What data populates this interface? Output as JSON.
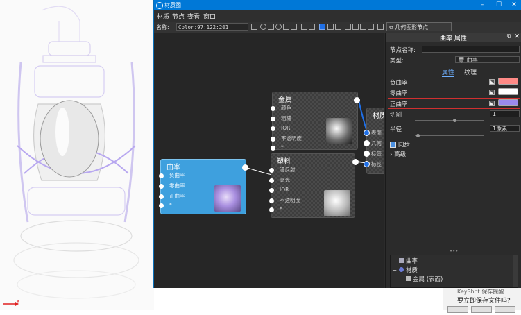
{
  "window": {
    "title": "材质图",
    "minimize": "–",
    "maximize": "☐",
    "close": "✕"
  },
  "menu": [
    "材质",
    "节点",
    "查看",
    "窗口"
  ],
  "toolbar": {
    "name_label": "名称:",
    "name_value": "Color:97:122:201",
    "geometry_button": "几何图形节点"
  },
  "nodes": {
    "metal": {
      "title": "金属",
      "pins": [
        "颜色",
        "粗糙",
        "IOR",
        "不透明度",
        "*"
      ]
    },
    "plastic": {
      "title": "塑料",
      "pins": [
        "漫反射",
        "高光",
        "IOR",
        "不透明度",
        "*"
      ]
    },
    "curvature": {
      "title": "曲率",
      "pins": [
        "负曲率",
        "零曲率",
        "正曲率",
        "*"
      ]
    },
    "material": {
      "title": "材质",
      "pins": [
        "表面",
        "几何",
        "标签",
        "标签"
      ]
    }
  },
  "props": {
    "header": "曲率 属性",
    "node_name_label": "节点名称:",
    "node_name_value": "",
    "type_label": "类型:",
    "type_value": "曲率",
    "tab_properties": "属性",
    "tab_texture": "纹理",
    "neg_label": "负曲率",
    "zero_label": "零曲率",
    "pos_label": "正曲率",
    "cut_label": "切割",
    "cut_value": "1",
    "radius_label": "半径",
    "radius_value": "1像素",
    "sync_label": "同步",
    "advanced_label": "高级",
    "dots": "•••",
    "colors": {
      "negative": "#ff8a86",
      "zero": "#ffffff",
      "positive": "#9a8aec"
    }
  },
  "tree": {
    "items": [
      "曲率",
      "材质",
      "金属 (表面)"
    ]
  },
  "dialog": {
    "title": "KeyShot 保存提醒",
    "question": "要立即保存文件吗?"
  },
  "viewport": {
    "axis": "x"
  }
}
